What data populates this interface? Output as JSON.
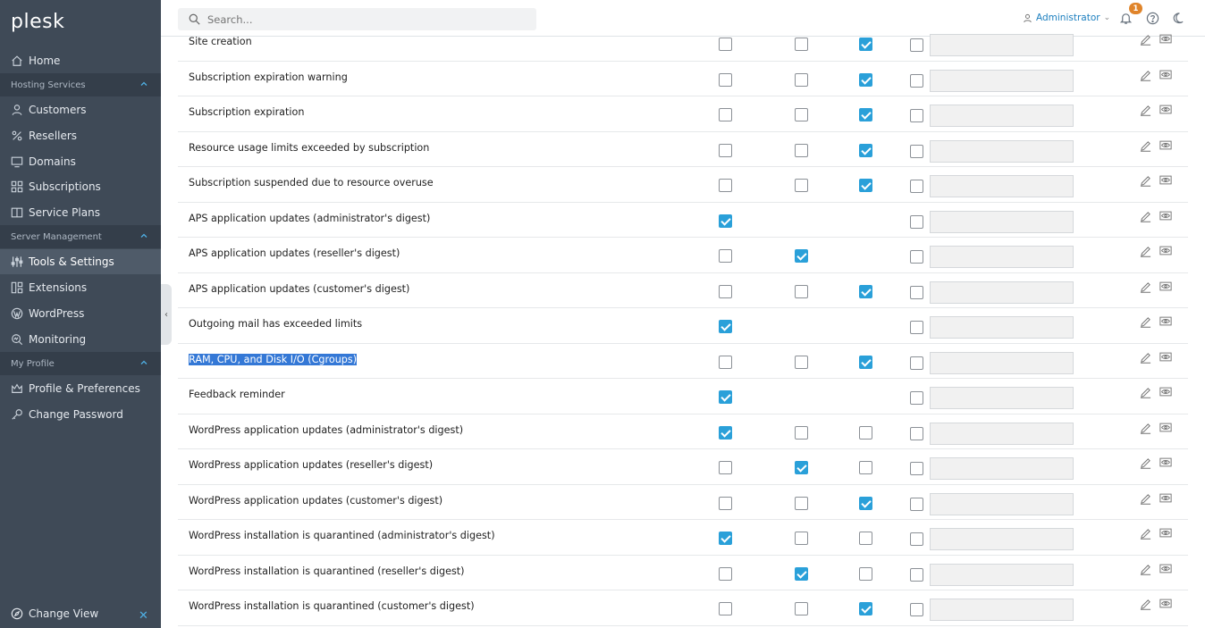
{
  "sidebar": {
    "logo": "plesk",
    "items": [
      {
        "label": "Home",
        "icon": "home-icon"
      },
      {
        "label": "Customers",
        "icon": "user-icon"
      },
      {
        "label": "Resellers",
        "icon": "percent-icon"
      },
      {
        "label": "Domains",
        "icon": "monitor-icon"
      },
      {
        "label": "Subscriptions",
        "icon": "grid-icon"
      },
      {
        "label": "Service Plans",
        "icon": "book-icon"
      },
      {
        "label": "Tools & Settings",
        "icon": "sliders-icon",
        "active": true
      },
      {
        "label": "Extensions",
        "icon": "extensions-icon"
      },
      {
        "label": "WordPress",
        "icon": "wordpress-icon"
      },
      {
        "label": "Monitoring",
        "icon": "monitoring-icon"
      },
      {
        "label": "Profile & Preferences",
        "icon": "profile-icon"
      },
      {
        "label": "Change Password",
        "icon": "key-icon"
      }
    ],
    "sections": [
      "Hosting Services",
      "Server Management",
      "My Profile"
    ],
    "change_view": "Change View"
  },
  "header": {
    "search_placeholder": "Search...",
    "user": "Administrator",
    "notifications_count": "1"
  },
  "accent_color": "#2aa0d9",
  "rows": [
    {
      "label": "Site creation",
      "checks": [
        false,
        false,
        true
      ],
      "fourth": false
    },
    {
      "label": "Subscription expiration warning",
      "checks": [
        false,
        false,
        true
      ],
      "fourth": false
    },
    {
      "label": "Subscription expiration",
      "checks": [
        false,
        false,
        true
      ],
      "fourth": false
    },
    {
      "label": "Resource usage limits exceeded by subscription",
      "checks": [
        false,
        false,
        true
      ],
      "fourth": false
    },
    {
      "label": "Subscription suspended due to resource overuse",
      "checks": [
        false,
        false,
        true
      ],
      "fourth": false
    },
    {
      "label": "APS application updates (administrator's digest)",
      "checks": [
        true,
        null,
        null
      ],
      "fourth": false
    },
    {
      "label": "APS application updates (reseller's digest)",
      "checks": [
        false,
        true,
        null
      ],
      "fourth": false
    },
    {
      "label": "APS application updates (customer's digest)",
      "checks": [
        false,
        false,
        true
      ],
      "fourth": false
    },
    {
      "label": "Outgoing mail has exceeded limits",
      "checks": [
        true,
        null,
        null
      ],
      "fourth": false
    },
    {
      "label": "RAM, CPU, and Disk I/O (Cgroups)",
      "checks": [
        false,
        false,
        true
      ],
      "fourth": false,
      "selected": true
    },
    {
      "label": "Feedback reminder",
      "checks": [
        true,
        null,
        null
      ],
      "fourth": false
    },
    {
      "label": "WordPress application updates (administrator's digest)",
      "checks": [
        true,
        false,
        false
      ],
      "fourth": false
    },
    {
      "label": "WordPress application updates (reseller's digest)",
      "checks": [
        false,
        true,
        false
      ],
      "fourth": false
    },
    {
      "label": "WordPress application updates (customer's digest)",
      "checks": [
        false,
        false,
        true
      ],
      "fourth": false
    },
    {
      "label": "WordPress installation is quarantined (administrator's digest)",
      "checks": [
        true,
        false,
        false
      ],
      "fourth": false
    },
    {
      "label": "WordPress installation is quarantined (reseller's digest)",
      "checks": [
        false,
        true,
        false
      ],
      "fourth": false
    },
    {
      "label": "WordPress installation is quarantined (customer's digest)",
      "checks": [
        false,
        false,
        true
      ],
      "fourth": false
    }
  ]
}
